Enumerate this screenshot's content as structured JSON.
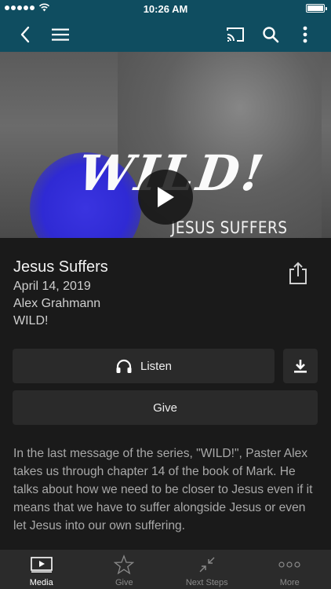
{
  "status_bar": {
    "time": "10:26 AM"
  },
  "hero": {
    "series_word": "WILD!",
    "subtitle": "JESUS SUFFERS"
  },
  "sermon": {
    "title": "Jesus Suffers",
    "date": "April 14, 2019",
    "speaker": "Alex Grahmann",
    "series": "WILD!",
    "description": "In the last message of the series, \"WILD!\", Paster Alex takes us through chapter 14 of the book of Mark. He talks about how we need to be closer to Jesus even if it means that we have to suffer alongside Jesus or even let Jesus into our own suffering."
  },
  "actions": {
    "listen_label": "Listen",
    "give_label": "Give"
  },
  "tabs": [
    {
      "label": "Media",
      "icon": "media-icon",
      "active": true
    },
    {
      "label": "Give",
      "icon": "star-icon",
      "active": false
    },
    {
      "label": "Next Steps",
      "icon": "compress-arrows-icon",
      "active": false
    },
    {
      "label": "More",
      "icon": "ellipsis-icon",
      "active": false
    }
  ],
  "colors": {
    "nav_bar": "#0f4d60",
    "background": "#1a1a1a",
    "button": "#2a2a2a",
    "tab_bar": "#2b2b2b",
    "accent_blue": "#2f2ad4"
  }
}
